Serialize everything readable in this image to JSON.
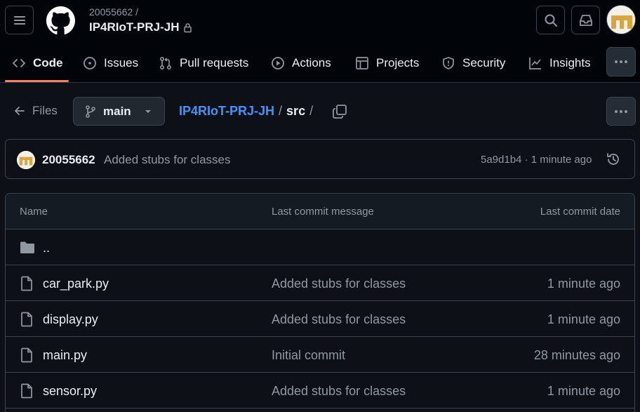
{
  "header": {
    "owner": "20055662 /",
    "repo": "IP4RIoT-PRJ-JH",
    "icons": [
      "menu-icon",
      "github-logo",
      "lock-icon",
      "search-icon",
      "inbox-icon",
      "avatar"
    ]
  },
  "tabs": [
    {
      "label": "Code",
      "icon": "code-icon",
      "active": true
    },
    {
      "label": "Issues",
      "icon": "issue-opened-icon"
    },
    {
      "label": "Pull requests",
      "icon": "pull-request-icon"
    },
    {
      "label": "Actions",
      "icon": "play-icon"
    },
    {
      "label": "Projects",
      "icon": "table-icon"
    },
    {
      "label": "Security",
      "icon": "shield-icon"
    },
    {
      "label": "Insights",
      "icon": "graph-icon"
    }
  ],
  "subheader": {
    "files_label": "Files",
    "branch": "main",
    "crumb_repo": "IP4RIoT-PRJ-JH",
    "crumb_sep": "/",
    "crumb_current": "src",
    "crumb_trailing": "/"
  },
  "commit": {
    "author": "20055662",
    "message": "Added stubs for classes",
    "meta": "5a9d1b4 · 1 minute ago"
  },
  "table": {
    "headers": {
      "name": "Name",
      "message": "Last commit message",
      "date": "Last commit date"
    },
    "parent": "..",
    "rows": [
      {
        "name": "car_park.py",
        "message": "Added stubs for classes",
        "date": "1 minute ago"
      },
      {
        "name": "display.py",
        "message": "Added stubs for classes",
        "date": "1 minute ago"
      },
      {
        "name": "main.py",
        "message": "Initial commit",
        "date": "28 minutes ago"
      },
      {
        "name": "sensor.py",
        "message": "Added stubs for classes",
        "date": "1 minute ago"
      }
    ]
  },
  "colors": {
    "accent": "#f78166",
    "link": "#4493f8",
    "bg": "#0d1117",
    "border": "#3d444d"
  }
}
